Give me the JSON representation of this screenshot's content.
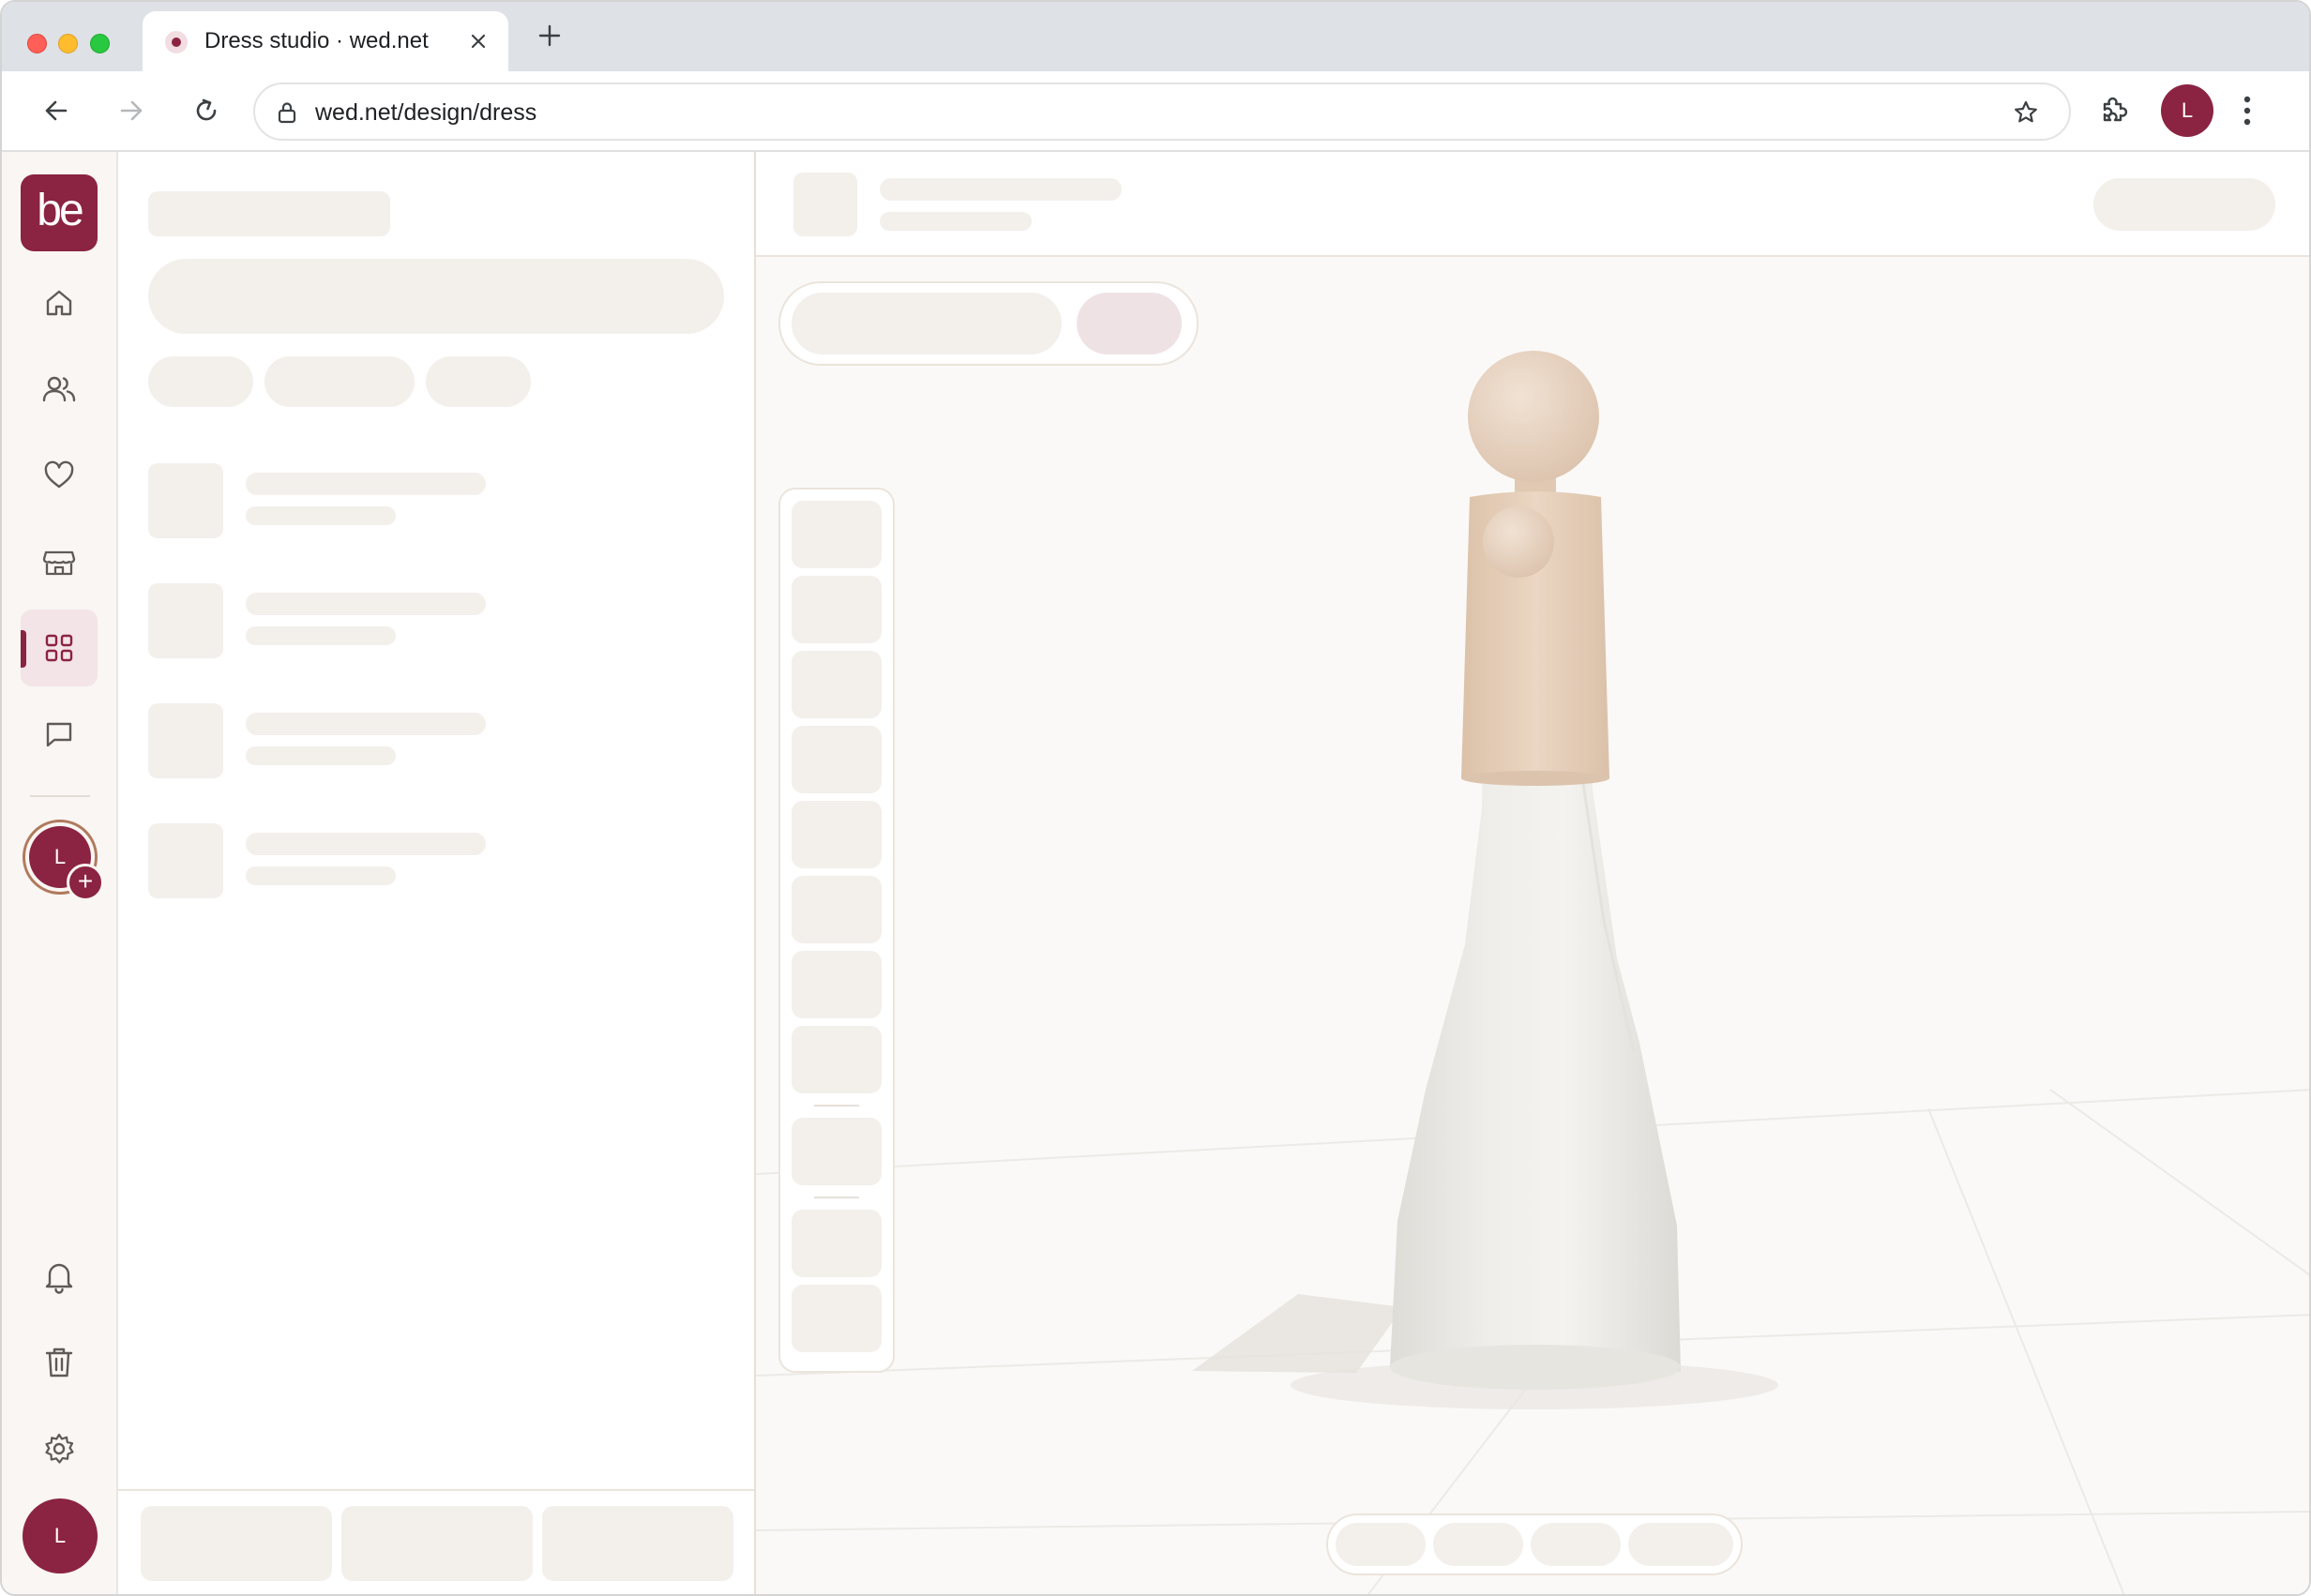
{
  "browser": {
    "tab_title": "Dress studio · wed.net",
    "url": "wed.net/design/dress",
    "profile_initial": "L"
  },
  "app": {
    "brand_logo_text": "be",
    "nav": [
      {
        "name": "home"
      },
      {
        "name": "guests"
      },
      {
        "name": "favorites"
      },
      {
        "name": "vendors"
      },
      {
        "name": "design",
        "active": true
      },
      {
        "name": "messages"
      }
    ],
    "add_partner_initial": "L",
    "user_initial": "L",
    "add_symbol": "+"
  },
  "theme": {
    "accent": "#8b2342",
    "skeleton": "#f3f0ec",
    "mannequin_skin": "#e8d4c2",
    "dress": "#ecebe7"
  }
}
